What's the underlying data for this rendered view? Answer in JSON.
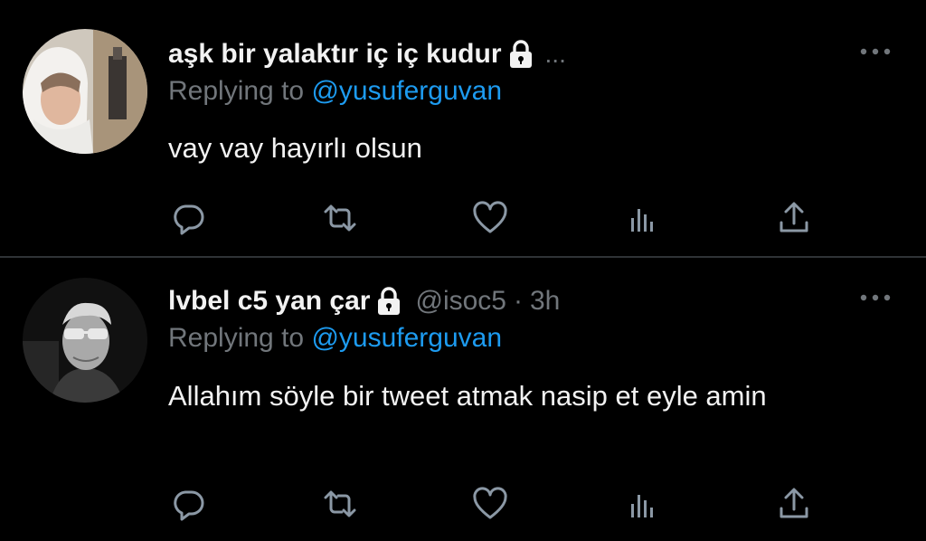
{
  "tweets": [
    {
      "display_name": "aşk bir yalaktır iç iç kudur",
      "truncation": "...",
      "replying_prefix": "Replying to ",
      "replying_handle": "@yusuferguvan",
      "text": "vay vay hayırlı olsun",
      "avatar_icon": "avatar-photo-hooded-man",
      "lock_icon": "lock-icon"
    },
    {
      "display_name": "lvbel c5 yan çar",
      "handle": "@isoc5",
      "separator": "·",
      "time": "3h",
      "replying_prefix": "Replying to ",
      "replying_handle": "@yusuferguvan",
      "text": "Allahım söyle bir tweet atmak nasip et eyle amin",
      "avatar_icon": "avatar-photo-sunglasses-man",
      "lock_icon": "lock-icon"
    }
  ],
  "action_icons": [
    "reply-icon",
    "retweet-icon",
    "like-icon",
    "views-icon",
    "share-icon"
  ],
  "colors": {
    "background": "#000000",
    "text": "#f2f2f2",
    "muted": "#71767b",
    "link": "#1d9bf0",
    "divider": "#2f3336"
  }
}
